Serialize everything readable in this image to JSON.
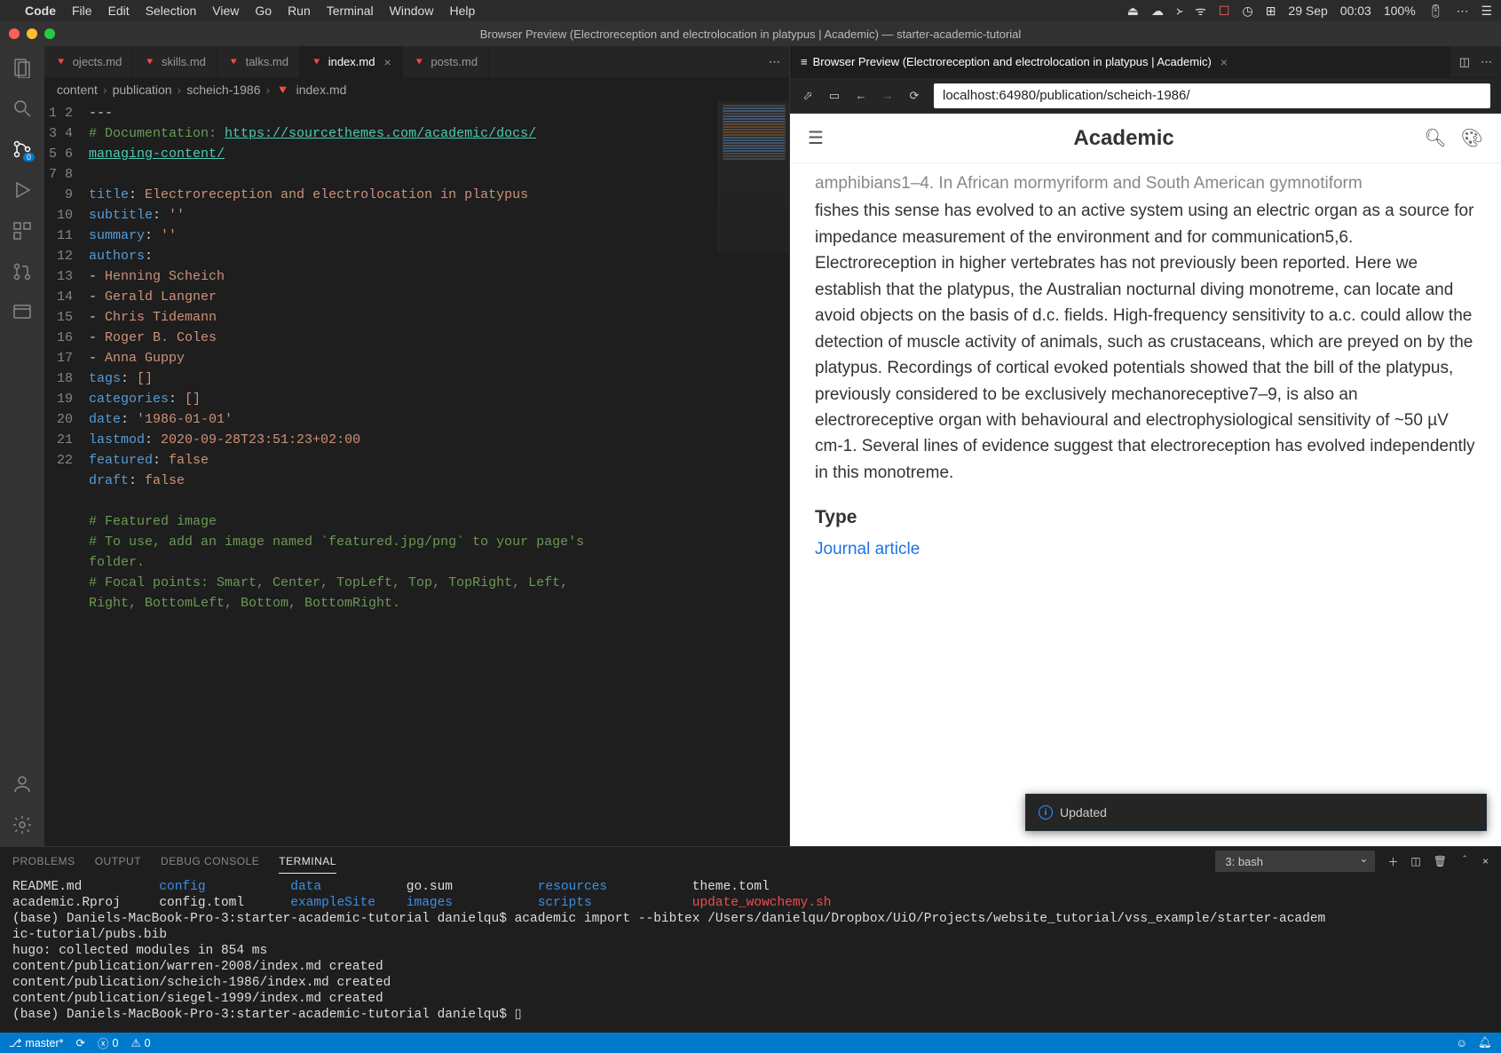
{
  "mac_menu": {
    "app": "Code",
    "items": [
      "File",
      "Edit",
      "Selection",
      "View",
      "Go",
      "Run",
      "Terminal",
      "Window",
      "Help"
    ],
    "date": "29 Sep",
    "time": "00:03",
    "battery": "100%"
  },
  "titlebar": "Browser Preview (Electroreception and electrolocation in platypus | Academic) — starter-academic-tutorial",
  "tabs_left": [
    {
      "label": "ojects.md",
      "active": false,
      "closable": false,
      "truncated": true
    },
    {
      "label": "skills.md",
      "active": false,
      "closable": false
    },
    {
      "label": "talks.md",
      "active": false,
      "closable": false
    },
    {
      "label": "index.md",
      "active": true,
      "closable": true
    },
    {
      "label": "posts.md",
      "active": false,
      "closable": false
    }
  ],
  "tabs_right": {
    "prefix_icon": "≡",
    "label": "Browser Preview (Electroreception and electrolocation in platypus | Academic)",
    "closable": true
  },
  "breadcrumb": [
    "content",
    "publication",
    "scheich-1986",
    "index.md"
  ],
  "code": {
    "lines": [
      {
        "n": 1,
        "txt": "---",
        "cls": ""
      },
      {
        "n": 2,
        "txt": "# Documentation: https://sourcethemes.com/academic/docs/",
        "cls": "com-link"
      },
      {
        "n": null,
        "txt": "managing-content/",
        "cls": "link-cont"
      },
      {
        "n": 3,
        "txt": "",
        "cls": ""
      },
      {
        "n": 4,
        "txt": "title: Electroreception and electrolocation in platypus",
        "cls": "kv"
      },
      {
        "n": 5,
        "txt": "subtitle: ''",
        "cls": "kv"
      },
      {
        "n": 6,
        "txt": "summary: ''",
        "cls": "kv"
      },
      {
        "n": 7,
        "txt": "authors:",
        "cls": "kv"
      },
      {
        "n": 8,
        "txt": "- Henning Scheich",
        "cls": "li"
      },
      {
        "n": 9,
        "txt": "- Gerald Langner",
        "cls": "li"
      },
      {
        "n": 10,
        "txt": "- Chris Tidemann",
        "cls": "li"
      },
      {
        "n": 11,
        "txt": "- Roger B. Coles",
        "cls": "li"
      },
      {
        "n": 12,
        "txt": "- Anna Guppy",
        "cls": "li"
      },
      {
        "n": 13,
        "txt": "tags: []",
        "cls": "kv"
      },
      {
        "n": 14,
        "txt": "categories: []",
        "cls": "kv"
      },
      {
        "n": 15,
        "txt": "date: '1986-01-01'",
        "cls": "kv"
      },
      {
        "n": 16,
        "txt": "lastmod: 2020-09-28T23:51:23+02:00",
        "cls": "kv"
      },
      {
        "n": 17,
        "txt": "featured: false",
        "cls": "kv"
      },
      {
        "n": 18,
        "txt": "draft: false",
        "cls": "kv"
      },
      {
        "n": 19,
        "txt": "",
        "cls": ""
      },
      {
        "n": 20,
        "txt": "# Featured image",
        "cls": "com"
      },
      {
        "n": 21,
        "txt": "# To use, add an image named `featured.jpg/png` to your page's",
        "cls": "com"
      },
      {
        "n": null,
        "txt": "folder.",
        "cls": "com-cont"
      },
      {
        "n": 22,
        "txt": "# Focal points: Smart, Center, TopLeft, Top, TopRight, Left,",
        "cls": "com"
      },
      {
        "n": null,
        "txt": "Right, BottomLeft, Bottom, BottomRight.",
        "cls": "com-cont"
      }
    ]
  },
  "preview": {
    "url": "localhost:64980/publication/scheich-1986/",
    "brand": "Academic",
    "body_text": "amphibians1–4. In African mormyriform and South American gymnotiform fishes this sense has evolved to an active system using an electric organ as a source for impedance measurement of the environment and for communication5,6. Electroreception in higher vertebrates has not previously been reported. Here we establish that the platypus, the Australian nocturnal diving monotreme, can locate and avoid objects on the basis of d.c. fields. High-frequency sensitivity to a.c. could allow the detection of muscle activity of animals, such as crustaceans, which are preyed on by the platypus. Recordings of cortical evoked potentials showed that the bill of the platypus, previously considered to be exclusively mechanoreceptive7–9, is also an electroreceptive organ with behavioural and electrophysiological sensitivity of ~50 µV cm-1. Several lines of evidence suggest that electroreception has evolved independently in this monotreme.",
    "type_heading": "Type",
    "type_value": "Journal article"
  },
  "panel": {
    "tabs": [
      "PROBLEMS",
      "OUTPUT",
      "DEBUG CONSOLE",
      "TERMINAL"
    ],
    "active_tab": "TERMINAL",
    "shell_label": "3: bash",
    "lines": [
      {
        "segs": [
          [
            "w",
            "README.md          "
          ],
          [
            "b",
            "config           "
          ],
          [
            "b",
            "data           "
          ],
          [
            "w",
            "go.sum           "
          ],
          [
            "b",
            "resources           "
          ],
          [
            "w",
            "theme.toml"
          ]
        ]
      },
      {
        "segs": [
          [
            "w",
            "academic.Rproj     "
          ],
          [
            "w",
            "config.toml      "
          ],
          [
            "b",
            "exampleSite    "
          ],
          [
            "b",
            "images           "
          ],
          [
            "b",
            "scripts             "
          ],
          [
            "r",
            "update_wowchemy.sh"
          ]
        ]
      },
      {
        "segs": [
          [
            "w",
            "(base) Daniels-MacBook-Pro-3:starter-academic-tutorial danielqu$ academic import --bibtex /Users/danielqu/Dropbox/UiO/Projects/website_tutorial/vss_example/starter-academ"
          ]
        ]
      },
      {
        "segs": [
          [
            "w",
            "ic-tutorial/pubs.bib"
          ]
        ]
      },
      {
        "segs": [
          [
            "w",
            "hugo: collected modules in 854 ms"
          ]
        ]
      },
      {
        "segs": [
          [
            "w",
            "content/publication/warren-2008/index.md created"
          ]
        ]
      },
      {
        "segs": [
          [
            "w",
            "content/publication/scheich-1986/index.md created"
          ]
        ]
      },
      {
        "segs": [
          [
            "w",
            "content/publication/siegel-1999/index.md created"
          ]
        ]
      },
      {
        "segs": [
          [
            "w",
            "(base) Daniels-MacBook-Pro-3:starter-academic-tutorial danielqu$ "
          ],
          [
            "w",
            "▯"
          ]
        ]
      }
    ]
  },
  "toast": {
    "text": "Updated"
  },
  "statusbar": {
    "branch": "master*",
    "errors": "0",
    "warnings": "0"
  },
  "activity_badge": "0"
}
